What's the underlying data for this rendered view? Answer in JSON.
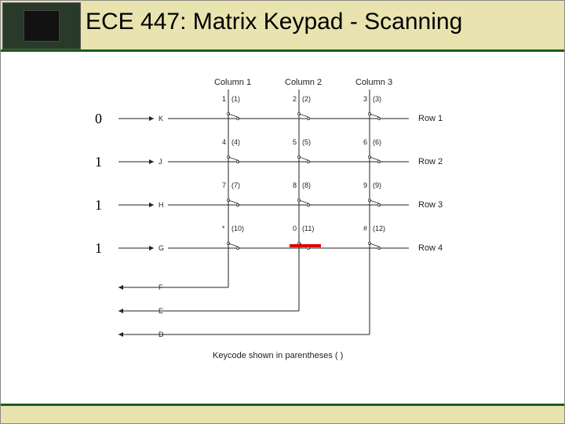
{
  "title": "ECE 447: Matrix Keypad - Scanning",
  "row_inputs": [
    "0",
    "1",
    "1",
    "1"
  ],
  "row_pins": [
    "K",
    "J",
    "H",
    "G"
  ],
  "col_pins": [
    "F",
    "E",
    "D"
  ],
  "col_headers": [
    "Column 1",
    "Column 2",
    "Column 3"
  ],
  "row_labels": [
    "Row 1",
    "Row 2",
    "Row 3",
    "Row 4"
  ],
  "keys": [
    {
      "r": 0,
      "c": 0,
      "face": "1",
      "code": "(1)"
    },
    {
      "r": 0,
      "c": 1,
      "face": "2",
      "code": "(2)"
    },
    {
      "r": 0,
      "c": 2,
      "face": "3",
      "code": "(3)"
    },
    {
      "r": 1,
      "c": 0,
      "face": "4",
      "code": "(4)"
    },
    {
      "r": 1,
      "c": 1,
      "face": "5",
      "code": "(5)"
    },
    {
      "r": 1,
      "c": 2,
      "face": "6",
      "code": "(6)"
    },
    {
      "r": 2,
      "c": 0,
      "face": "7",
      "code": "(7)"
    },
    {
      "r": 2,
      "c": 1,
      "face": "8",
      "code": "(8)"
    },
    {
      "r": 2,
      "c": 2,
      "face": "9",
      "code": "(9)"
    },
    {
      "r": 3,
      "c": 0,
      "face": "*",
      "code": "(10)"
    },
    {
      "r": 3,
      "c": 1,
      "face": "0",
      "code": "(11)"
    },
    {
      "r": 3,
      "c": 2,
      "face": "#",
      "code": "(12)"
    }
  ],
  "highlight_key": {
    "r": 3,
    "c": 1
  },
  "footnote": "Keycode shown in parentheses ( )",
  "diagram_geometry": {
    "col_x": [
      170,
      260,
      350
    ],
    "row_y": [
      55,
      110,
      165,
      220
    ],
    "col_out_y": [
      270,
      300,
      330
    ]
  }
}
